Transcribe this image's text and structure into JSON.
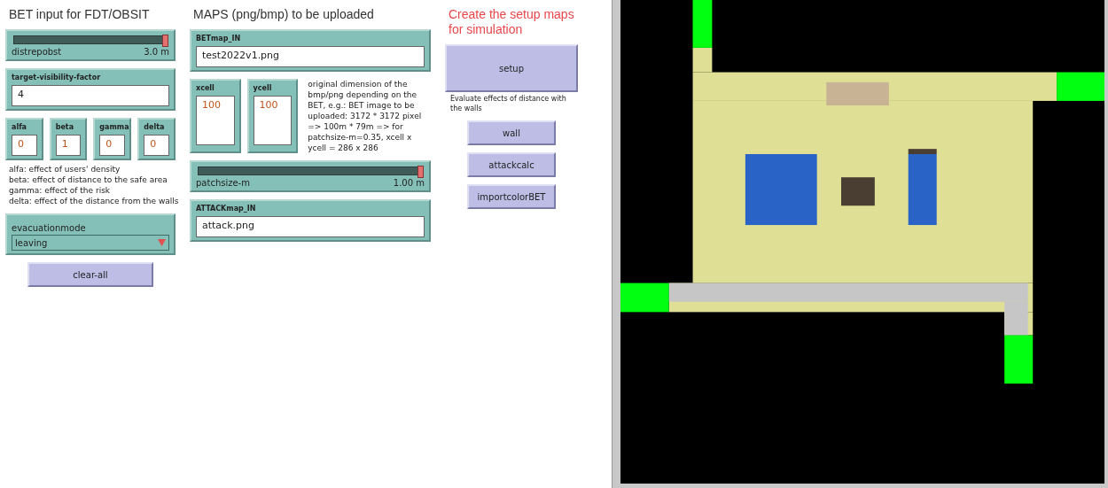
{
  "columns": [
    {
      "heading": {
        "text": "BET input for FDT/OBSIT",
        "kind": "plain"
      },
      "widgets": [
        {
          "kind": "slider",
          "label": "distrepobst",
          "reading": "3.0 m",
          "level": 1.0
        },
        {
          "kind": "input",
          "label": "target-visibility-factor",
          "value": "4"
        },
        {
          "kind": "inputs",
          "items": [
            {
              "label": "alfa",
              "value": "0"
            },
            {
              "label": "beta",
              "value": "1"
            },
            {
              "label": "gamma",
              "value": "0"
            },
            {
              "label": "delta",
              "value": "0"
            }
          ]
        },
        {
          "kind": "note",
          "lines": [
            "alfa: effect of users' density",
            "beta: effect of distance to the safe area",
            "gamma: effect of the risk",
            "delta: effect of the distance from the walls"
          ]
        },
        {
          "kind": "chooser",
          "label": "evacuationmode",
          "value": "leaving"
        },
        {
          "kind": "button",
          "label": "clear-all"
        }
      ]
    },
    {
      "heading": {
        "text": "MAPS (png/bmp) to be uploaded",
        "kind": "plain"
      },
      "widgets": [
        {
          "kind": "input",
          "label": "BETmap_IN",
          "value": "test2022v1.png"
        },
        {
          "kind": "cells",
          "items": [
            {
              "label": "xcell",
              "value": "100"
            },
            {
              "label": "ycell",
              "value": "100"
            }
          ],
          "note": "original dimension of the bmp/png depending on the BET, e.g.: BET image to be uploaded: 3172 * 3172 pixel => 100m * 79m => for patchsize-m=0.35, xcell x ycell = 286 x 286"
        },
        {
          "kind": "slider",
          "label": "patchsize-m",
          "reading": "1.00 m",
          "level": 1.0
        },
        {
          "kind": "input",
          "label": "ATTACKmap_IN",
          "value": "attack.png"
        }
      ]
    },
    {
      "heading": {
        "text": "Create the setup maps for simulation",
        "kind": "accent"
      },
      "widgets": [
        {
          "kind": "bigbutton",
          "label": "setup"
        },
        {
          "kind": "smallnote",
          "text": "Evaluate effects of distance with the walls"
        },
        {
          "kind": "button",
          "label": "wall"
        },
        {
          "kind": "button",
          "label": "attackcalc"
        },
        {
          "kind": "button",
          "label": "importcolorBET"
        }
      ]
    }
  ]
}
